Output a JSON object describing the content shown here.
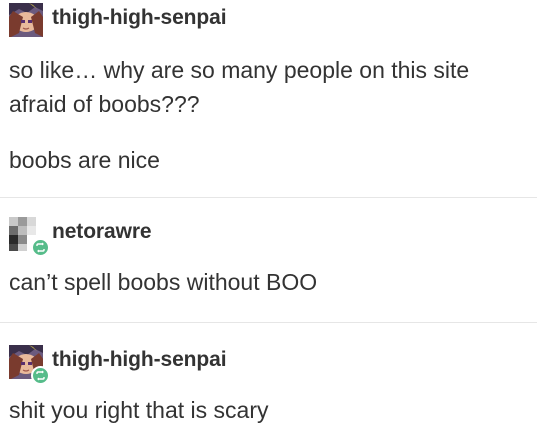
{
  "posts": [
    {
      "username": "thigh-high-senpai",
      "avatar_icon": "anime-character-avatar-icon",
      "reblogged": false,
      "paragraphs": [
        "so like… why are so many people on this site",
        "afraid of boobs???",
        "boobs are nice"
      ]
    },
    {
      "username": "netorawre",
      "avatar_icon": "pixelated-avatar-icon",
      "reblogged": true,
      "paragraphs": [
        "can’t spell boobs without BOO"
      ]
    },
    {
      "username": "thigh-high-senpai",
      "avatar_icon": "anime-character-avatar-icon",
      "reblogged": true,
      "paragraphs": [
        "shit you right that is scary"
      ]
    }
  ],
  "colors": {
    "text": "#333333",
    "reblog_green": "#56bc8a",
    "divider": "#e6e6e6"
  }
}
